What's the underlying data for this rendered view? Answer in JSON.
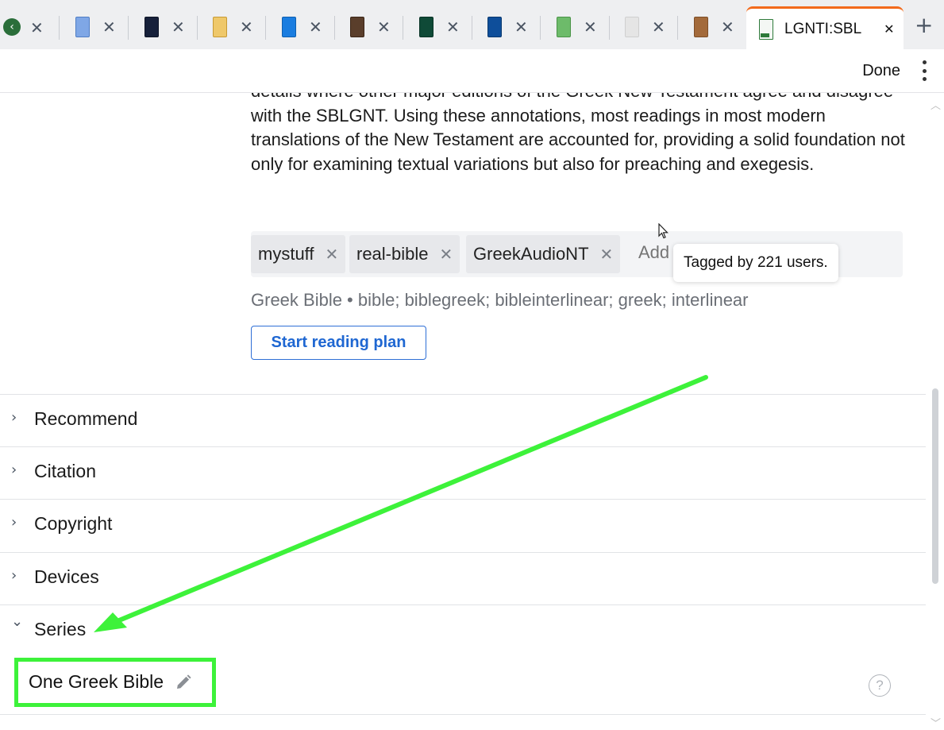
{
  "tabs": [
    {
      "thumb_color": "#7fa7e6",
      "thumb_border": "#4f7dc4"
    },
    {
      "thumb_color": "#16203a",
      "thumb_border": "#0d1426"
    },
    {
      "thumb_color": "#efc86a",
      "thumb_border": "#c79a35"
    },
    {
      "thumb_color": "#1a7de0",
      "thumb_border": "#0f5fb0"
    },
    {
      "thumb_color": "#5a3e2b",
      "thumb_border": "#3b2516"
    },
    {
      "thumb_color": "#0f4a37",
      "thumb_border": "#083326"
    },
    {
      "thumb_color": "#0e4e9a",
      "thumb_border": "#08386f"
    },
    {
      "thumb_color": "#6dbb6a",
      "thumb_border": "#4a9347"
    },
    {
      "thumb_color": "#e5e5e5",
      "thumb_border": "#cfcfcf"
    },
    {
      "thumb_color": "#a36a3b",
      "thumb_border": "#7d4e27"
    }
  ],
  "active_tab": {
    "label": "LGNTI:SBL",
    "accent": "#f26a1b"
  },
  "toolbar": {
    "done_label": "Done"
  },
  "description": "details where other major editions of the Greek New Testament agree and disagree with the SBLGNT. Using these annotations, most readings in most modern translations of the New Testament are accounted for, providing a solid foundation not only for examining textual variations but also for preaching and exegesis.",
  "tags": [
    "mystuff",
    "real-bible",
    "GreekAudioNT"
  ],
  "tag_input_placeholder": "Add",
  "tooltip": "Tagged by 221 users.",
  "meta_line": "Greek Bible • bible; biblegreek; bibleinterlinear; greek; interlinear",
  "reading_plan_button": "Start reading plan",
  "sections": [
    {
      "title": "Recommend",
      "expanded": false
    },
    {
      "title": "Citation",
      "expanded": false
    },
    {
      "title": "Copyright",
      "expanded": false
    },
    {
      "title": "Devices",
      "expanded": false
    },
    {
      "title": "Series",
      "expanded": true
    }
  ],
  "series_value": "One Greek Bible",
  "help_glyph": "?",
  "annotation_color": "#3df23a"
}
